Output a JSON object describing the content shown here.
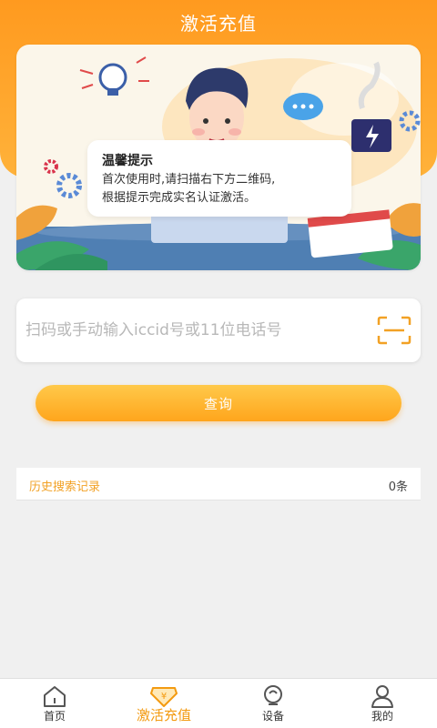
{
  "header": {
    "title": "激活充值"
  },
  "tip": {
    "title": "温馨提示",
    "line1": "首次使用时,请扫描右下方二维码,",
    "line2": "根据提示完成实名认证激活。"
  },
  "search": {
    "placeholder": "扫码或手动输入iccid号或11位电话号",
    "value": ""
  },
  "query_button": {
    "label": "查询"
  },
  "history": {
    "title": "历史搜索记录",
    "count": "0条"
  },
  "tabbar": {
    "items": [
      {
        "label": "首页",
        "icon": "home-icon"
      },
      {
        "label": "激活充值",
        "icon": "yuan-badge-icon",
        "active": true
      },
      {
        "label": "设备",
        "icon": "device-icon"
      },
      {
        "label": "我的",
        "icon": "user-icon"
      }
    ]
  },
  "colors": {
    "primary": "#ff9a1f",
    "accent_text": "#f2a125",
    "active_tab": "#f39a10"
  }
}
